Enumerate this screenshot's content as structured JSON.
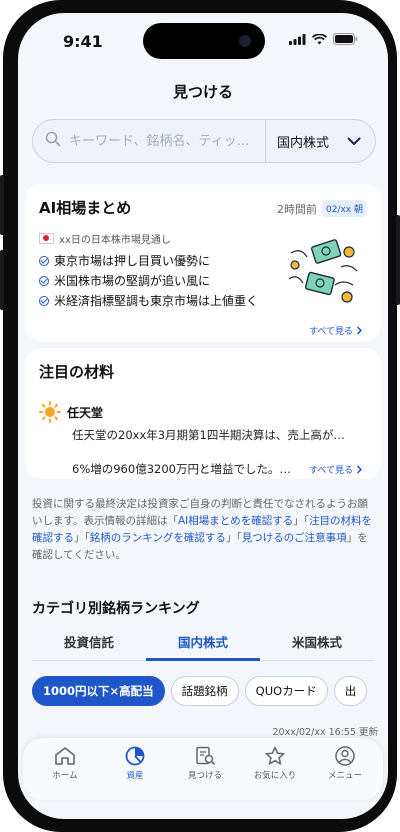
{
  "status": {
    "time": "9:41"
  },
  "header": {
    "title": "見つける"
  },
  "search": {
    "placeholder": "キーワード、銘柄名、ティッ...",
    "market": "国内株式"
  },
  "ai_card": {
    "title": "AI相場まとめ",
    "updated": "2時間前",
    "badge": "02/xx 朝",
    "subtitle": "xx日の日本株市場見通し",
    "bullets": [
      "東京市場は押し目買い優勢に",
      "米国株市場の堅調が追い風に",
      "米経済指標堅調も東京市場は上値重く"
    ],
    "more": "すべて見る"
  },
  "material_card": {
    "title": "注目の材料",
    "stock": "任天堂",
    "news_line1": "任天堂の20xx年3月期第1四半期決算は、売上高が…",
    "news_line2": "6%増の960億3200万円と増益でした。…",
    "more": "すべて見る"
  },
  "disclaimer": {
    "t1": "投資に関する最終決定は投資家ご自身の判断と責任でなされるようお願いします。表示情報の詳細は「",
    "l1": "AI相場まとめを確認する",
    "t2": "」「",
    "l2": "注目の材料を確認する",
    "t3": "」「",
    "l3": "銘柄のランキングを確認する",
    "t4": "」「",
    "l4": "見つけるのご注意事項",
    "t5": "」を確認してください。"
  },
  "ranking": {
    "title": "カテゴリ別銘柄ランキング",
    "tabs": [
      "投資信託",
      "国内株式",
      "米国株式"
    ],
    "chips": [
      "1000円以下×高配当",
      "話題銘柄",
      "QUOカード",
      "出"
    ],
    "updated": "20xx/02/xx 16:55 更新"
  },
  "tabbar": {
    "items": [
      "ホーム",
      "資産",
      "見つける",
      "お気に入り",
      "メニュー"
    ]
  },
  "colors": {
    "accent": "#1f57c9",
    "background": "#f3f6fa"
  }
}
